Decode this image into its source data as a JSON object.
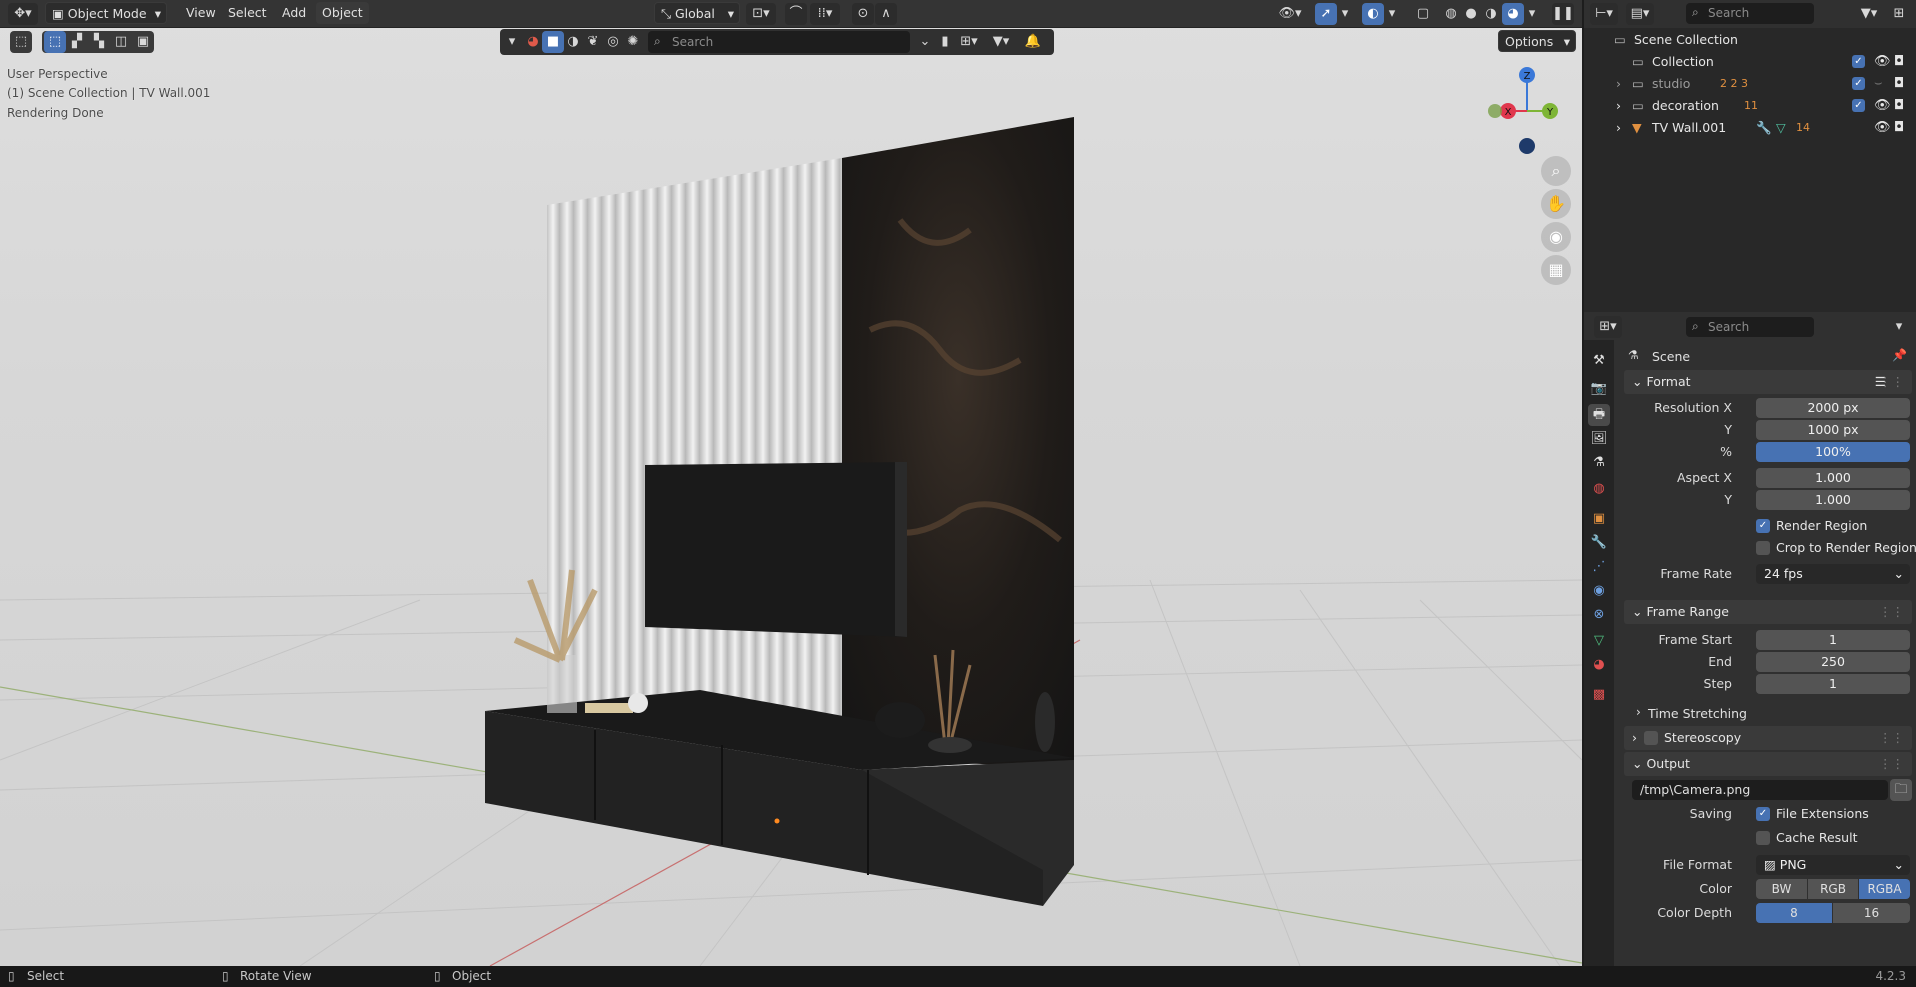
{
  "viewport_header": {
    "mode_label": "Object Mode",
    "menu": [
      "View",
      "Select",
      "Add",
      "Object"
    ],
    "orientation_label": "Global",
    "options_label": "Options",
    "search_placeholder": "Search"
  },
  "viewport_overlay": {
    "line1": "User Perspective",
    "line2": "(1) Scene Collection | TV Wall.001",
    "line3": "Rendering Done"
  },
  "gizmo": {
    "z": "Z",
    "x": "X",
    "y": "Y"
  },
  "outliner": {
    "search_placeholder": "Search",
    "root": "Scene Collection",
    "items": [
      {
        "label": "Collection",
        "badges": ""
      },
      {
        "label": "studio",
        "badges": "2 2 3"
      },
      {
        "label": "decoration",
        "badges": "11"
      },
      {
        "label": "TV Wall.001",
        "badges": "14"
      }
    ]
  },
  "properties": {
    "search_placeholder": "Search",
    "context": "Scene",
    "format": {
      "title": "Format",
      "res_x_label": "Resolution X",
      "res_x": "2000 px",
      "res_y_label": "Y",
      "res_y": "1000 px",
      "pct_label": "%",
      "pct": "100%",
      "aspect_x_label": "Aspect X",
      "aspect_x": "1.000",
      "aspect_y_label": "Y",
      "aspect_y": "1.000",
      "render_region": "Render Region",
      "crop_region": "Crop to Render Region",
      "frame_rate_label": "Frame Rate",
      "frame_rate": "24 fps"
    },
    "frame_range": {
      "title": "Frame Range",
      "start_label": "Frame Start",
      "start": "1",
      "end_label": "End",
      "end": "250",
      "step_label": "Step",
      "step": "1",
      "time_stretching": "Time Stretching"
    },
    "stereoscopy": {
      "title": "Stereoscopy"
    },
    "output": {
      "title": "Output",
      "path": "/tmp\\Camera.png",
      "saving_label": "Saving",
      "file_extensions": "File Extensions",
      "cache_result": "Cache Result",
      "file_format_label": "File Format",
      "file_format": "PNG",
      "color_label": "Color",
      "color_options": [
        "BW",
        "RGB",
        "RGBA"
      ],
      "color_selected": "RGBA",
      "depth_label": "Color Depth",
      "depth_options": [
        "8",
        "16"
      ],
      "depth_selected": "8"
    }
  },
  "statusbar": {
    "select": "Select",
    "rotate": "Rotate View",
    "object": "Object",
    "version": "4.2.3"
  },
  "colors": {
    "accent": "#4772b3",
    "x_axis": "#e0374d",
    "y_axis": "#7eb536",
    "z_axis": "#3a78d8"
  }
}
